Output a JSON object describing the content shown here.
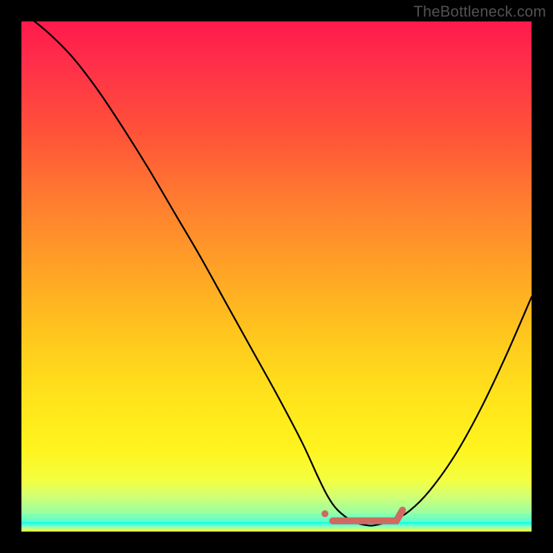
{
  "watermark": "TheBottleneck.com",
  "colors": {
    "frame": "#000000",
    "curve": "#000000",
    "marker": "#cf6a61",
    "watermark": "#525252"
  },
  "chart_data": {
    "type": "line",
    "title": "",
    "xlabel": "",
    "ylabel": "",
    "xlim": [
      0,
      100
    ],
    "ylim": [
      0,
      100
    ],
    "series": [
      {
        "name": "bottleneck-curve",
        "x": [
          0,
          5,
          10,
          15,
          20,
          25,
          30,
          35,
          40,
          45,
          50,
          55,
          58,
          60,
          62,
          65,
          68,
          70,
          73,
          76,
          80,
          85,
          90,
          95,
          100
        ],
        "y": [
          102,
          98,
          93,
          86.5,
          79,
          71,
          62.5,
          54,
          45,
          36,
          27,
          17.5,
          11,
          7,
          4.2,
          2,
          1.2,
          1.4,
          2.3,
          4,
          8,
          15,
          24,
          34.5,
          46
        ]
      }
    ],
    "markers": {
      "name": "optimal-range",
      "shape": "segment-with-dot",
      "dot": {
        "x": 59.5,
        "y": 3.5
      },
      "segment_start": {
        "x": 61,
        "y": 2.1
      },
      "segment_end": {
        "x": 73.5,
        "y": 2.1
      },
      "hook": {
        "x": 74.7,
        "y": 4.2
      }
    },
    "background_gradient_stops": [
      {
        "pct": 0,
        "color": "#ff1a4b"
      },
      {
        "pct": 50,
        "color": "#ffb021"
      },
      {
        "pct": 85,
        "color": "#fff41e"
      },
      {
        "pct": 100,
        "color": "#1effdf"
      }
    ]
  }
}
